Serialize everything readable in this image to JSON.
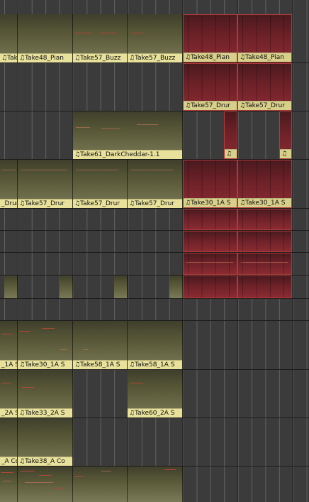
{
  "labels": {
    "c1": "♫Take48_Pian",
    "c2": "♫Take48_Pian",
    "c3": "♫Take57_Buzz",
    "c4": "♫Take57_Buzz",
    "c5": "♫Take48_Pian",
    "c6": "♫Take48_Pian",
    "c7": "♫Take57_Drur",
    "c8": "♫Take57_Drur",
    "c9": "♫Take61_DarkCheddar-1.1",
    "c10": "♫",
    "c11": "♫",
    "c12": "_Drur",
    "c13": "♫Take57_Drur",
    "c14": "♫Take57_Drur",
    "c15": "♫Take57_Drur",
    "c16": "♫Take30_1A S",
    "c17": "♫Take30_1A S",
    "c18": "_1A S",
    "c19": "♫Take30_1A S",
    "c20": "♫Take58_1A S",
    "c21": "♫Take58_1A S",
    "c22": "_2A S",
    "c23": "♫Take33_2A S",
    "c24": "♫Take60_2A S",
    "c25": "_A Co",
    "c26": "♫Take38_A Co"
  }
}
